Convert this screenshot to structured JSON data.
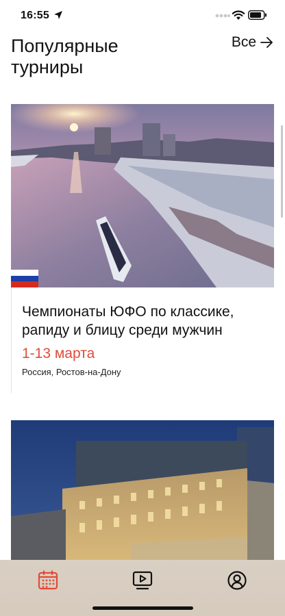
{
  "status_bar": {
    "time": "16:55"
  },
  "header": {
    "title": "Популярные турниры",
    "see_all_label": "Все"
  },
  "tournaments": [
    {
      "title": "Чемпионаты ЮФО по классике, рапиду и блицу среди мужчин",
      "dates": "1-13 марта",
      "location": "Россия, Ростов-на-Дону",
      "flag": [
        "#ffffff",
        "#1c3fa8",
        "#d52b1e"
      ]
    },
    {
      "title": "",
      "dates": "",
      "location": ""
    }
  ],
  "tab_bar": {
    "items": [
      {
        "icon": "calendar-icon",
        "active": true
      },
      {
        "icon": "video-icon",
        "active": false
      },
      {
        "icon": "profile-icon",
        "active": false
      }
    ]
  },
  "colors": {
    "accent": "#e14b38",
    "dates": "#e14b38",
    "tab_bar_bg": "#d8cdbf"
  }
}
